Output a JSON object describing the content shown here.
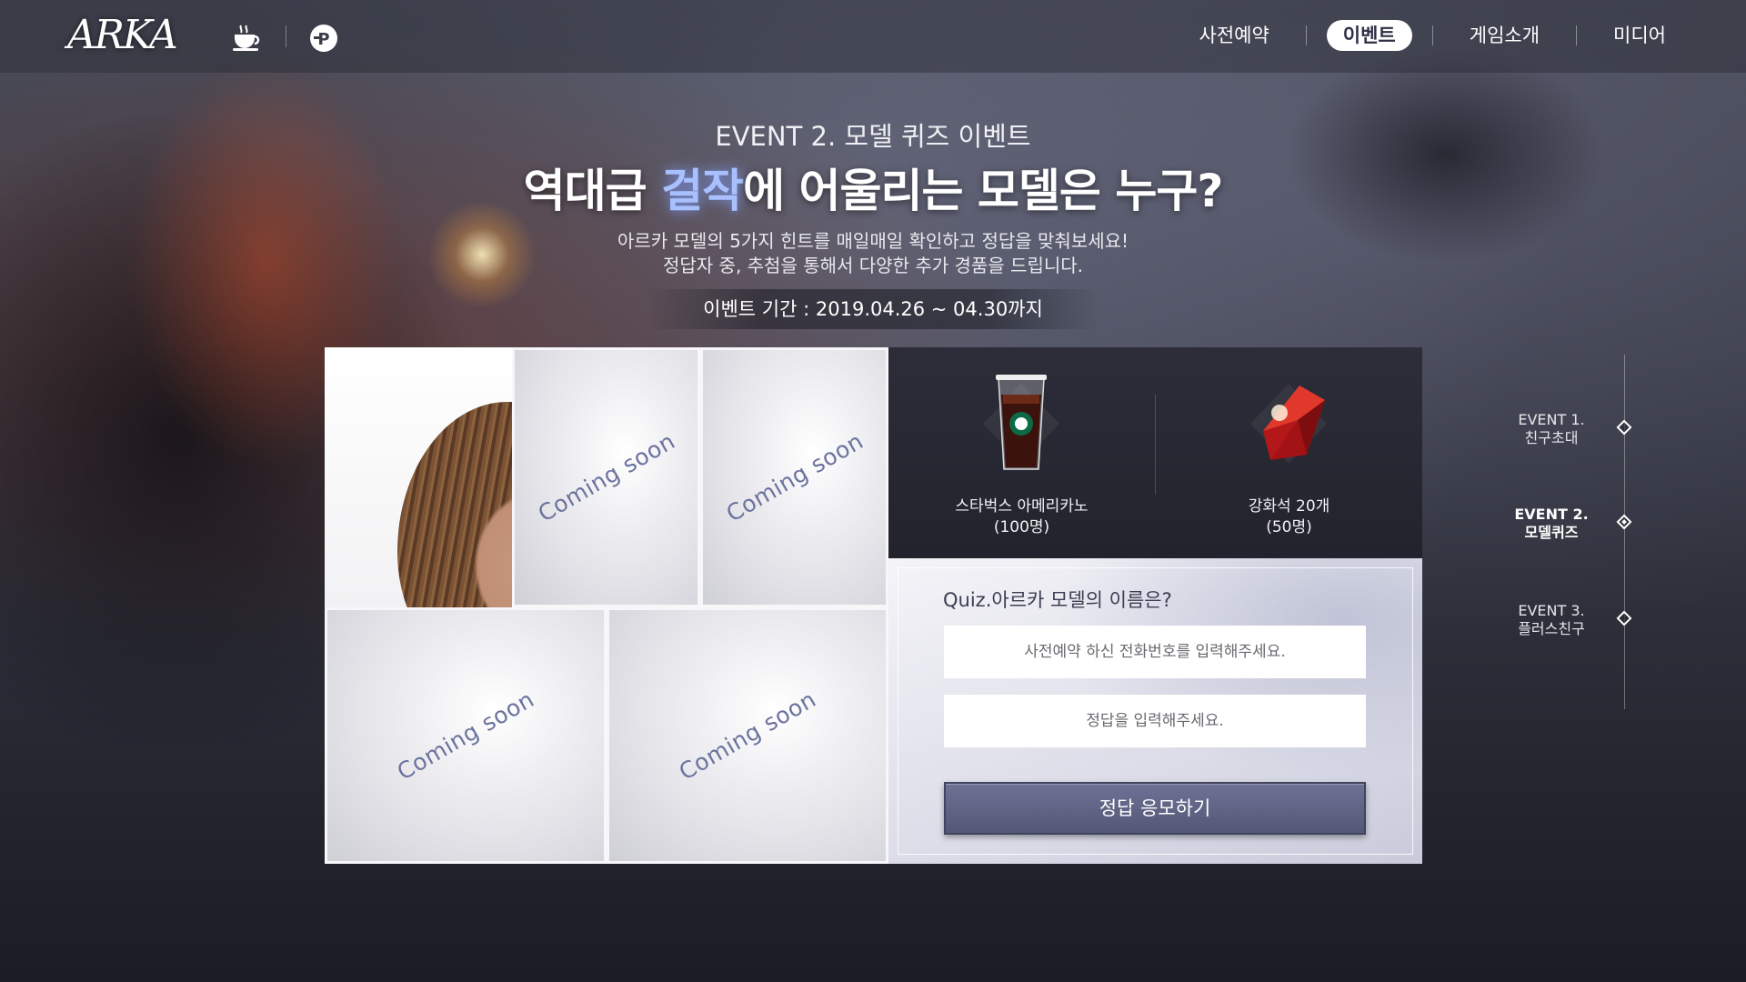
{
  "header": {
    "logo": "ARKA",
    "icons": [
      "coffee-cup-icon",
      "pmang-icon"
    ],
    "nav": [
      {
        "label": "사전예약",
        "active": false
      },
      {
        "label": "이벤트",
        "active": true
      },
      {
        "label": "게임소개",
        "active": false
      },
      {
        "label": "미디어",
        "active": false
      }
    ]
  },
  "hero": {
    "event_tag": "EVENT 2. 모델 퀴즈 이벤트",
    "headline_before": "역대급 ",
    "headline_highlight": "걸작",
    "headline_after": "에 어울리는 모델은 누구?",
    "desc_line1": "아르카 모델의 5가지 힌트를 매일매일 확인하고 정답을 맞춰보세요!",
    "desc_line2": "정답자 중, 추첨을 통해서 다양한 추가 경품을 드립니다.",
    "period": "이벤트 기간 : 2019.04.26 ~ 04.30까지"
  },
  "tiles": {
    "coming_soon": "Coming soon"
  },
  "rewards": [
    {
      "name": "스타벅스 아메리카노",
      "count": "(100명)",
      "icon": "iced-americano-icon"
    },
    {
      "name": "강화석 20개",
      "count": "(50명)",
      "icon": "red-gem-icon"
    }
  ],
  "quiz": {
    "question": "Quiz.아르카 모델의 이름은?",
    "phone_placeholder": "사전예약 하신 전화번호를 입력해주세요.",
    "answer_placeholder": "정답을 입력해주세요.",
    "submit_label": "정답 응모하기"
  },
  "side_nav": [
    {
      "line1": "EVENT 1.",
      "line2": "친구초대",
      "active": false
    },
    {
      "line1": "EVENT 2.",
      "line2": "모델퀴즈",
      "active": true
    },
    {
      "line1": "EVENT 3.",
      "line2": "플러스친구",
      "active": false
    }
  ],
  "colors": {
    "accent": "#a9c0ff",
    "button": "#5f6384",
    "rewards_bg": "#26272f",
    "active_nav_text": "#2e3146"
  }
}
